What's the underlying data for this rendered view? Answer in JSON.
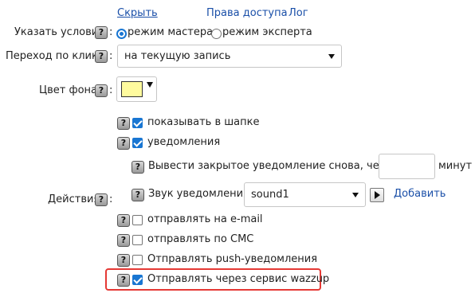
{
  "top_links": {
    "hide": "Скрыть",
    "access_rights": "Права доступа",
    "log": "Лог"
  },
  "conditions": {
    "label": "Указать условия",
    "help": "?",
    "options": [
      "режим мастера",
      "режим эксперта"
    ],
    "selected": "режим мастера"
  },
  "click_transition": {
    "label": "Переход по клику",
    "help": "?",
    "value": "на текущую запись"
  },
  "background": {
    "label": "Цвет фона",
    "help": "?",
    "color": "#fffb9e"
  },
  "actions": {
    "label": "Действия",
    "help": "?",
    "items": {
      "show_in_header": {
        "label": "показывать в шапке",
        "checked": true
      },
      "notifications": {
        "label": "уведомления",
        "checked": true
      },
      "repeat": {
        "label": "Вывести закрытое уведомление снова, через :",
        "value": "",
        "unit": "минут"
      },
      "sound": {
        "label": "Звук уведомления:",
        "value": "sound1",
        "add": "Добавить"
      },
      "email": {
        "label": "отправлять на e-mail",
        "checked": false
      },
      "sms": {
        "label": "отправлять по СМС",
        "checked": false
      },
      "push": {
        "label": "Отправлять push-уведомления",
        "checked": false
      },
      "wazzup": {
        "label": "Отправлять через сервис wazzup",
        "checked": true
      }
    }
  },
  "colors": {
    "highlight": "#e53935",
    "accent": "#1976d2",
    "link": "#1a4fa8"
  }
}
